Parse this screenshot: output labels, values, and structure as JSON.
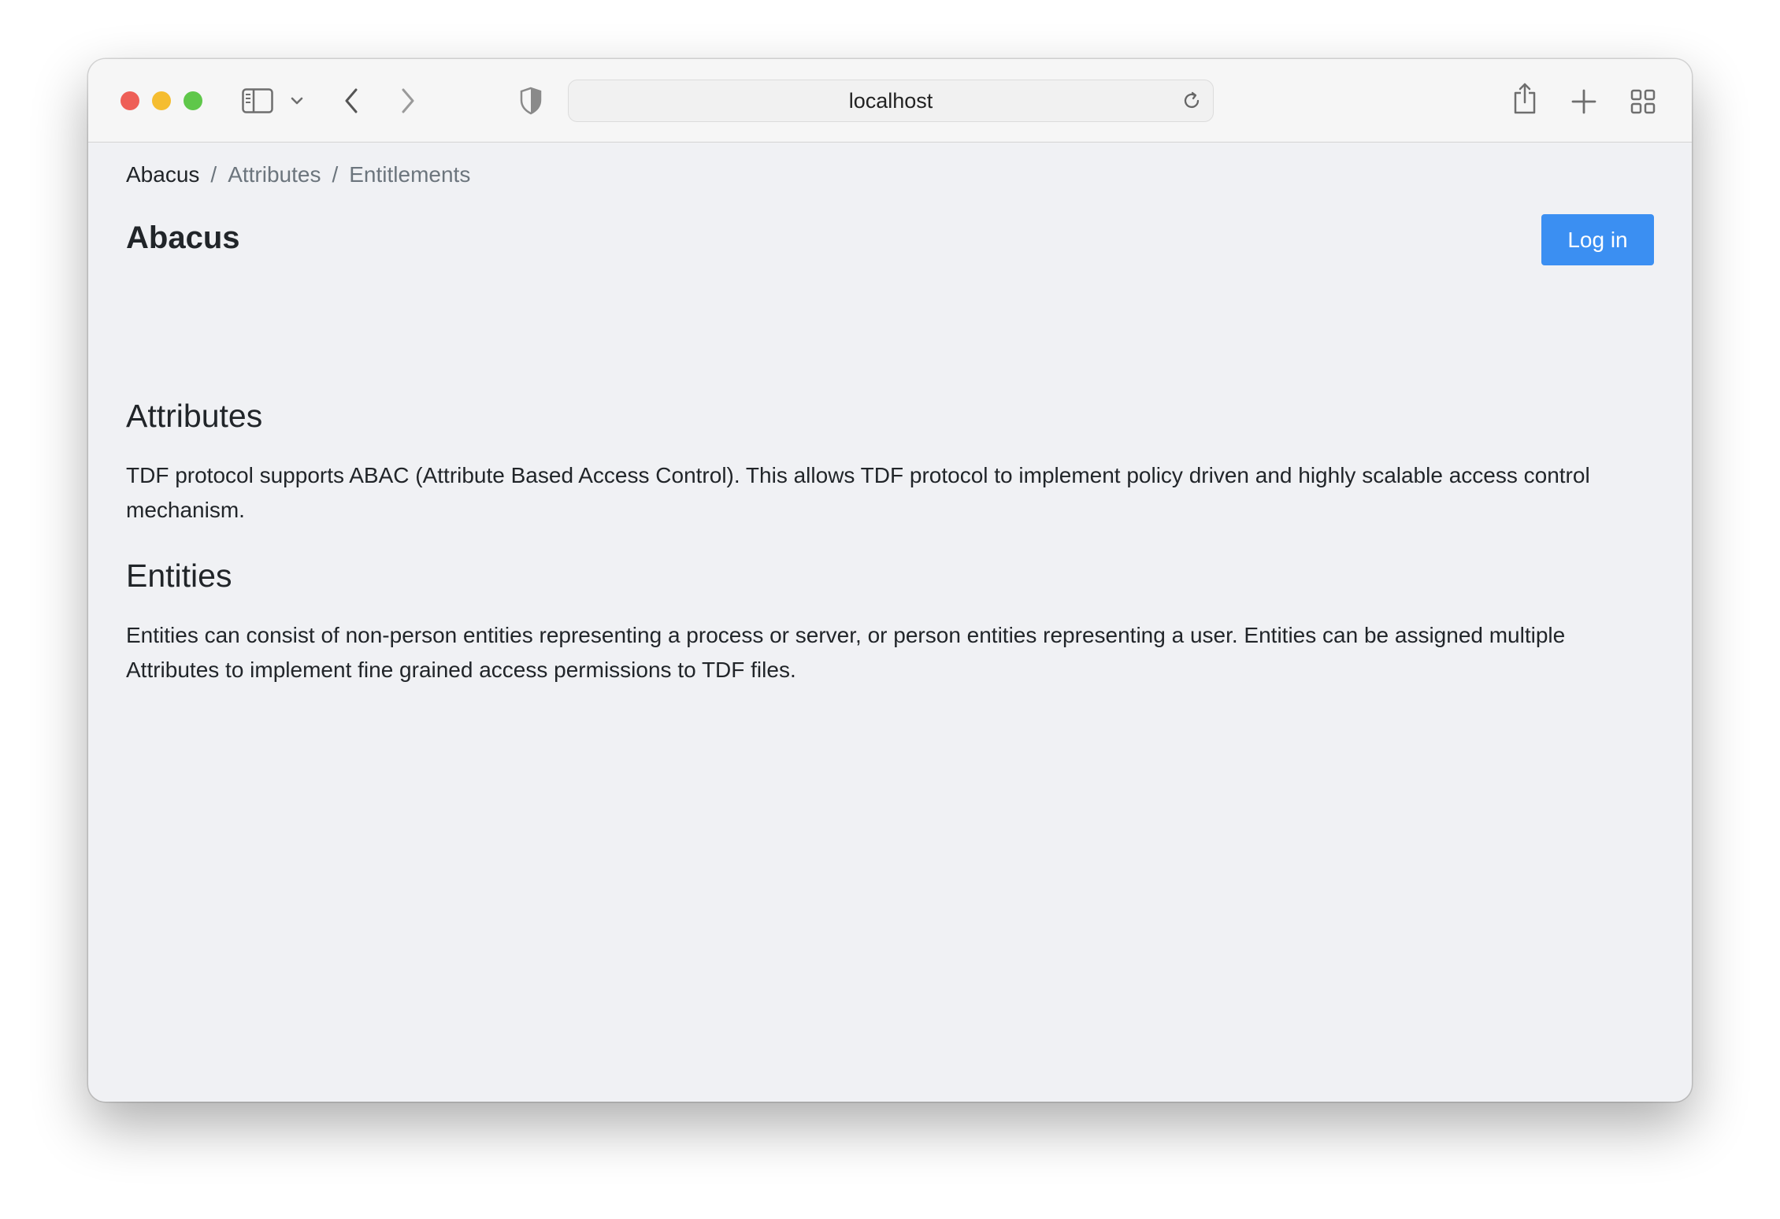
{
  "browser": {
    "address": "localhost",
    "icons": {
      "sidebar": "sidebar-icon",
      "sidebar_menu": "chevron-down-icon",
      "back": "chevron-left-icon",
      "forward": "chevron-right-icon",
      "privacy": "shield-icon",
      "reload": "reload-icon",
      "share": "share-icon",
      "new_tab": "plus-icon",
      "tab_overview": "grid-icon"
    },
    "traffic_lights": {
      "close": "#ee5f57",
      "minimize": "#f5bd30",
      "maximize": "#5fc74a"
    }
  },
  "breadcrumb": {
    "items": [
      "Abacus",
      "Attributes",
      "Entitlements"
    ],
    "separator": "/"
  },
  "header": {
    "title": "Abacus",
    "login_label": "Log in",
    "login_color": "#3b8ff2"
  },
  "sections": [
    {
      "heading": "Attributes",
      "text": "TDF protocol supports ABAC (Attribute Based Access Control). This allows TDF protocol to implement policy driven and highly scalable access control mechanism."
    },
    {
      "heading": "Entities",
      "text": "Entities can consist of non-person entities representing a process or server, or person entities representing a user. Entities can be assigned multiple Attributes to implement fine grained access permissions to TDF files."
    }
  ]
}
